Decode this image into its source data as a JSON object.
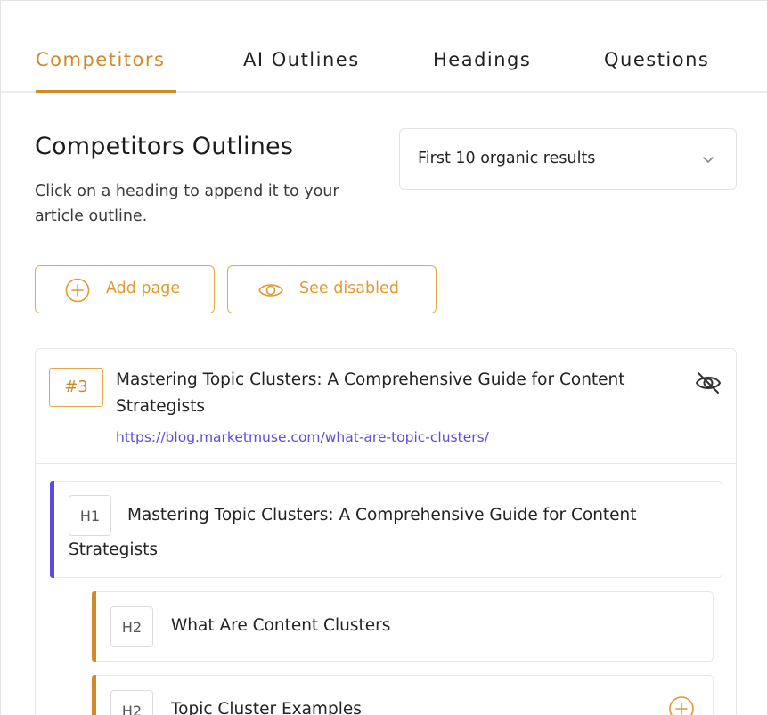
{
  "tabs": [
    {
      "label": "Competitors",
      "active": true
    },
    {
      "label": "AI Outlines",
      "active": false
    },
    {
      "label": "Headings",
      "active": false
    },
    {
      "label": "Questions",
      "active": false
    }
  ],
  "header": {
    "title": "Competitors Outlines",
    "description": "Click on a heading to append it to your article outline."
  },
  "results_select": {
    "value": "First 10 organic results",
    "icon": "chevron-down-icon"
  },
  "actions": {
    "add_page_label": "Add page",
    "add_page_icon": "plus-circle-icon",
    "see_disabled_label": "See disabled",
    "see_disabled_icon": "eye-icon"
  },
  "competitor": {
    "rank": "#3",
    "title": "Mastering Topic Clusters: A Comprehensive Guide for Content Strategists",
    "url": "https://blog.marketmuse.com/what-are-topic-clusters/",
    "hide_icon": "eye-off-icon",
    "headings": [
      {
        "level": "H1",
        "text": "Mastering Topic Clusters: A Comprehensive Guide for Content Strategists"
      },
      {
        "level": "H2",
        "text": "What Are Content Clusters"
      },
      {
        "level": "H2",
        "text": "Topic Cluster Examples"
      }
    ]
  },
  "colors": {
    "accent": "#d08a2a",
    "button_accent": "#e09a32",
    "h1_marker": "#5b4de0",
    "link": "#5b4de0"
  }
}
